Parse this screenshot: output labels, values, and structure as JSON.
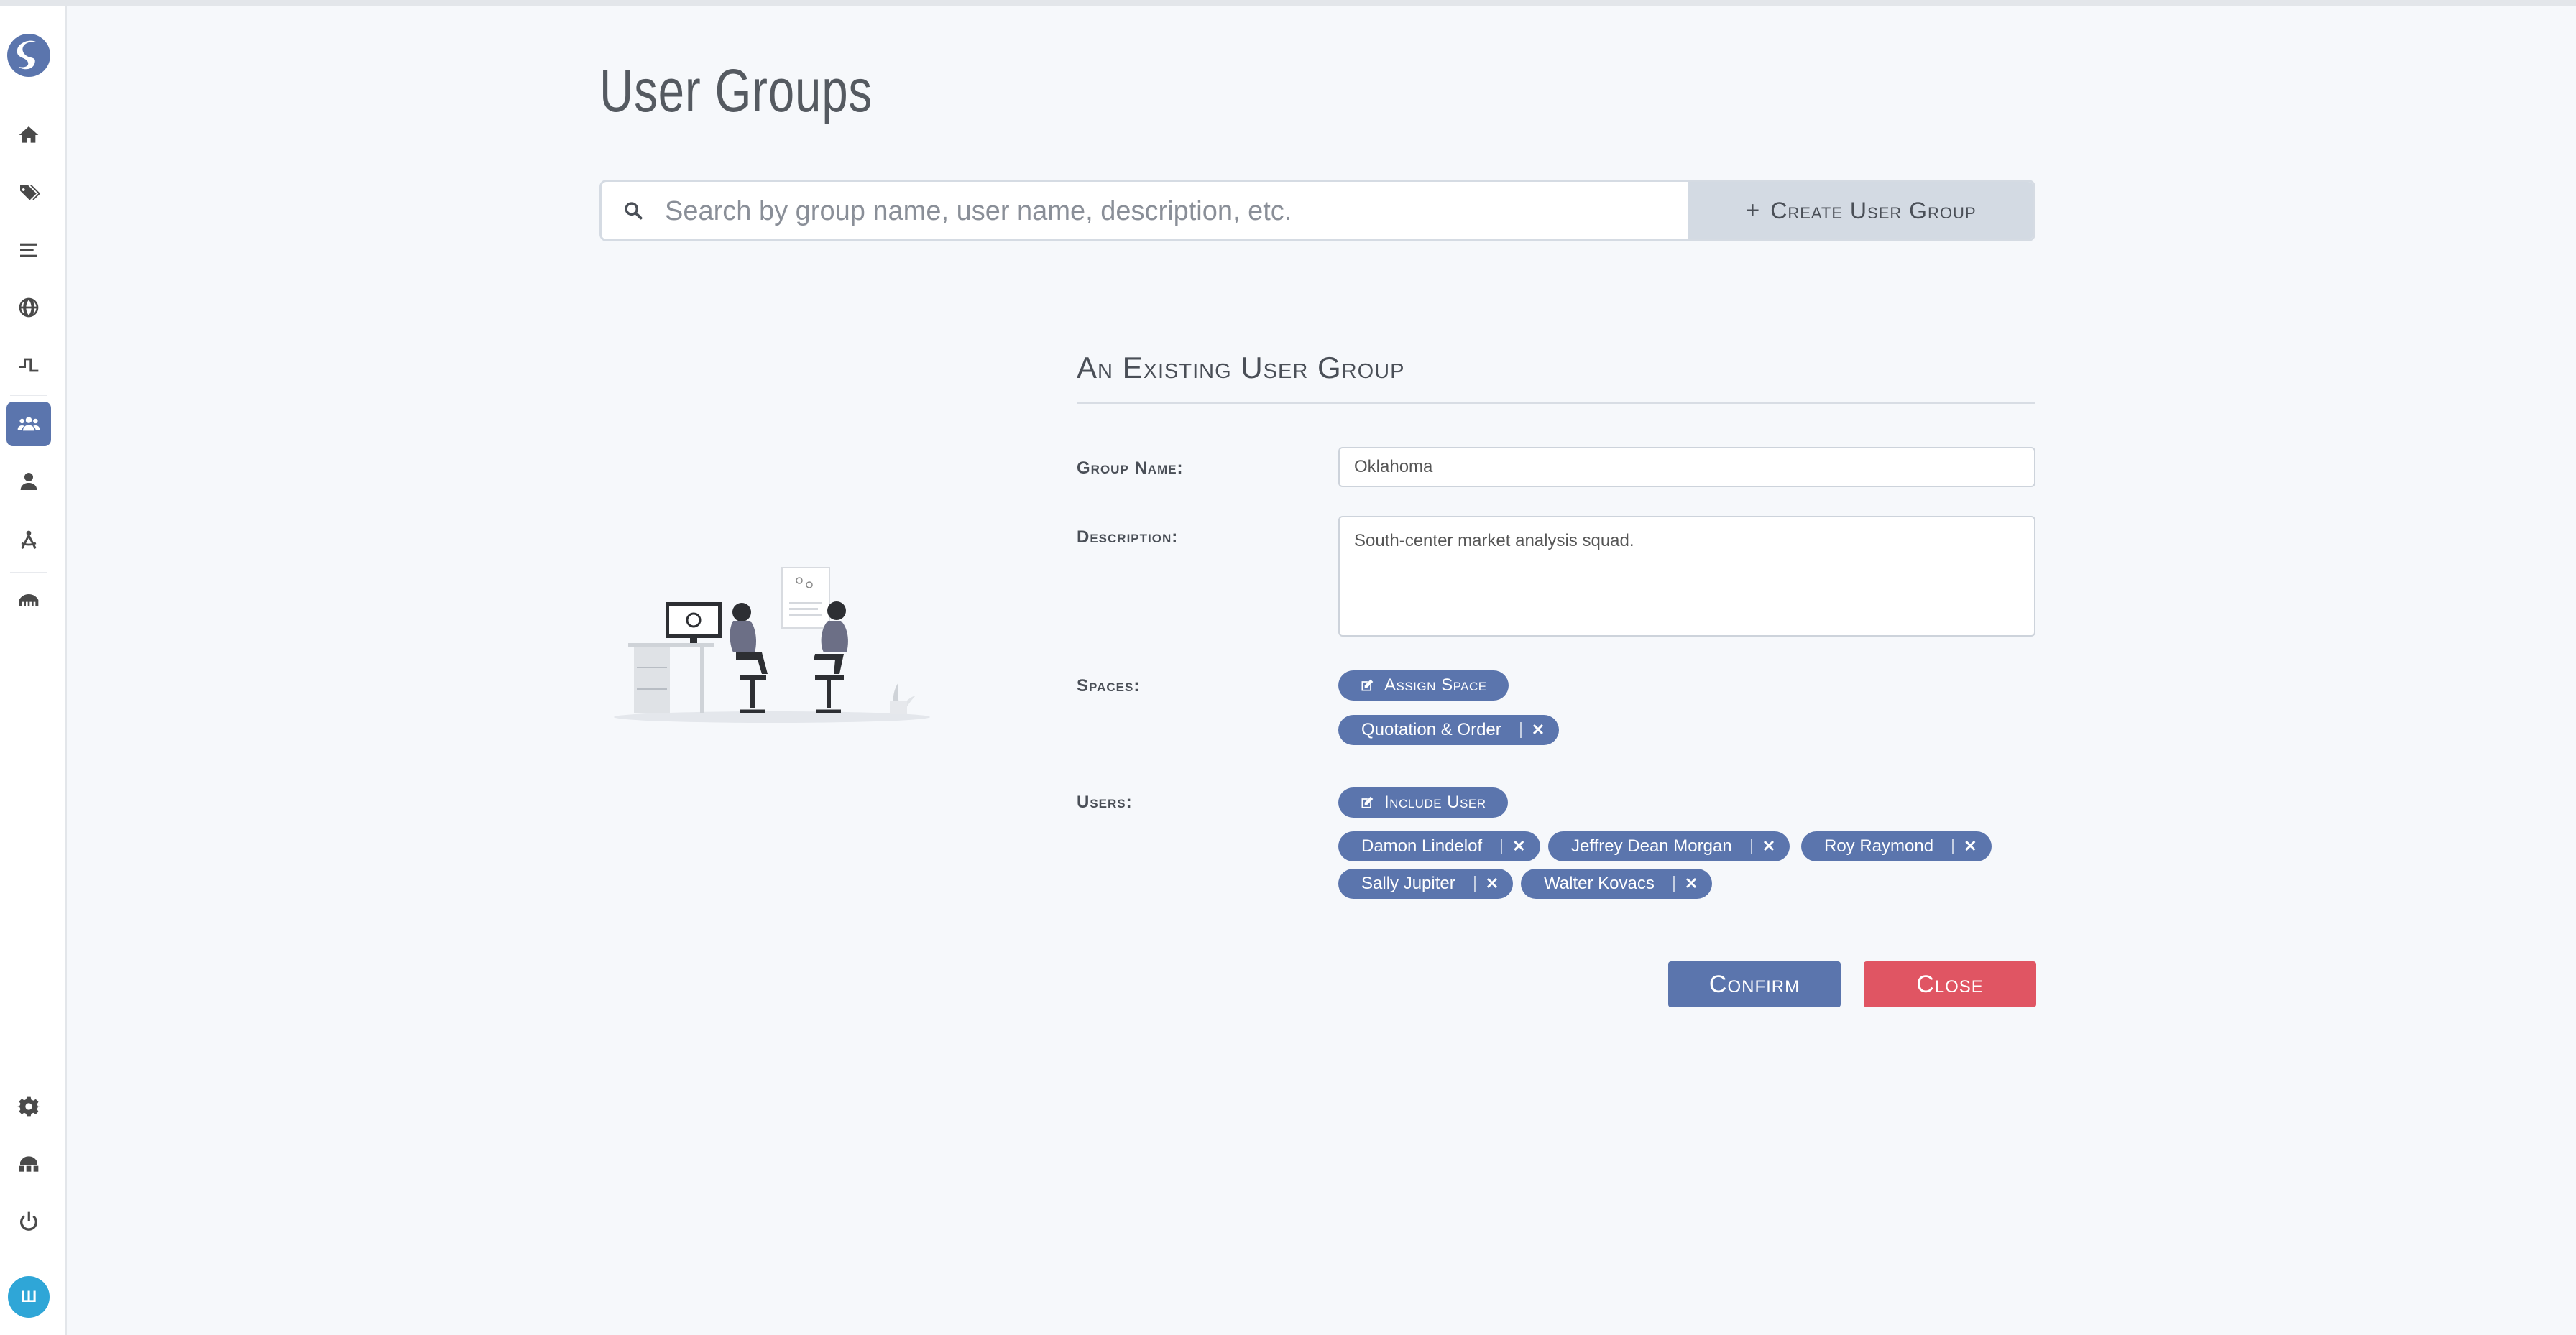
{
  "page": {
    "title": "User Groups"
  },
  "search": {
    "placeholder": "Search by group name, user name, description, etc.",
    "create_label": "Create User Group"
  },
  "form": {
    "title": "An Existing User Group",
    "group_name_label": "Group Name:",
    "group_name_value": "Oklahoma",
    "description_label": "Description:",
    "description_value": "South-center market analysis squad.",
    "spaces_label": "Spaces:",
    "assign_space_label": "Assign Space",
    "spaces": [
      "Quotation & Order"
    ],
    "users_label": "Users:",
    "include_user_label": "Include User",
    "users": [
      "Damon Lindelof",
      "Jeffrey Dean Morgan",
      "Roy Raymond",
      "Sally Jupiter",
      "Walter Kovacs"
    ],
    "remove_symbol": "✕",
    "confirm_label": "Confirm",
    "close_label": "Close"
  },
  "sidebar": {
    "items": [
      {
        "icon": "home-icon"
      },
      {
        "icon": "tags-icon"
      },
      {
        "icon": "list-icon"
      },
      {
        "icon": "globe-icon"
      },
      {
        "icon": "pulse-icon"
      },
      {
        "icon": "users-icon",
        "active": true
      },
      {
        "icon": "user-icon"
      },
      {
        "icon": "drafting-compass-icon"
      },
      {
        "icon": "archive-icon"
      }
    ],
    "bottom": [
      {
        "icon": "gear-icon"
      },
      {
        "icon": "network-icon"
      },
      {
        "icon": "power-icon"
      }
    ],
    "avatar_initials": "Ш"
  },
  "colors": {
    "accent": "#5b75ad",
    "danger": "#e05563",
    "avatar": "#2fa6d7"
  }
}
